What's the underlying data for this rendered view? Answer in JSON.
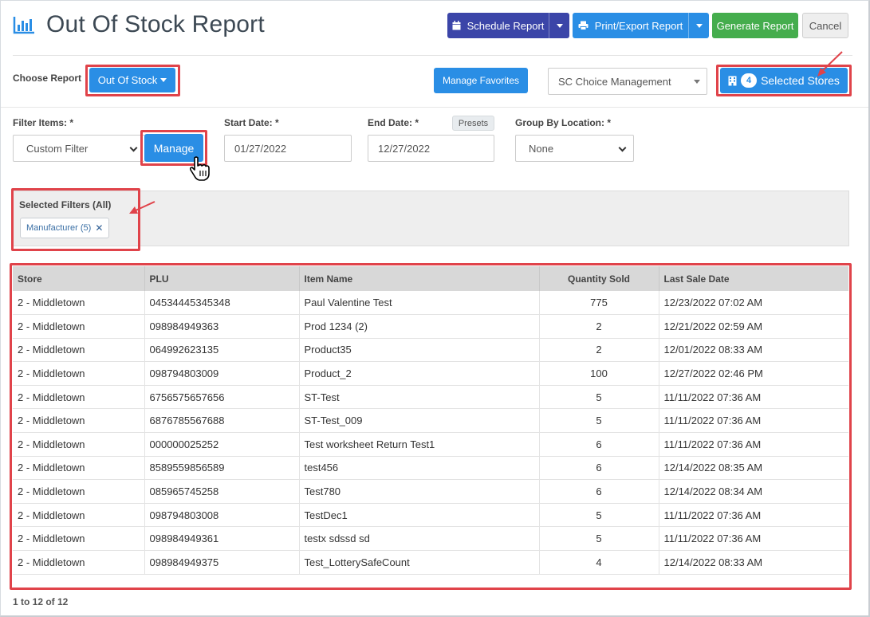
{
  "header": {
    "title": "Out Of Stock Report",
    "title_icon": "bar-chart-icon",
    "schedule_label": "Schedule Report",
    "print_label": "Print/Export Report",
    "generate_label": "Generate Report",
    "cancel_label": "Cancel"
  },
  "report_bar": {
    "choose_label": "Choose Report",
    "report_value": "Out Of Stock",
    "manage_favorites_label": "Manage Favorites",
    "location_value": "SC Choice Management",
    "stores_count": "4",
    "stores_label": "Selected Stores"
  },
  "filters": {
    "filter_items_label": "Filter Items: *",
    "filter_value": "Custom Filter",
    "manage_label": "Manage",
    "start_label": "Start Date: *",
    "start_value": "01/27/2022",
    "end_label": "End Date: *",
    "end_value": "12/27/2022",
    "presets_label": "Presets",
    "group_label": "Group By Location: *",
    "group_value": "None"
  },
  "selected_filters": {
    "title": "Selected Filters (All)",
    "tags": [
      {
        "label": "Manufacturer (5)",
        "remove": "✕"
      }
    ]
  },
  "table": {
    "columns": [
      "Store",
      "PLU",
      "Item Name",
      "Quantity Sold",
      "Last Sale Date"
    ],
    "rows": [
      [
        "2 - Middletown",
        "04534445345348",
        "Paul Valentine Test",
        "775",
        "12/23/2022 07:02 AM"
      ],
      [
        "2 - Middletown",
        "098984949363",
        "Prod 1234 (2)",
        "2",
        "12/21/2022 02:59 AM"
      ],
      [
        "2 - Middletown",
        "064992623135",
        "Product35",
        "2",
        "12/01/2022 08:33 AM"
      ],
      [
        "2 - Middletown",
        "098794803009",
        "Product_2",
        "100",
        "12/27/2022 02:46 PM"
      ],
      [
        "2 - Middletown",
        "6756575657656",
        "ST-Test",
        "5",
        "11/11/2022 07:36 AM"
      ],
      [
        "2 - Middletown",
        "6876785567688",
        "ST-Test_009",
        "5",
        "11/11/2022 07:36 AM"
      ],
      [
        "2 - Middletown",
        "000000025252",
        "Test worksheet Return Test1",
        "6",
        "11/11/2022 07:36 AM"
      ],
      [
        "2 - Middletown",
        "8589559856589",
        "test456",
        "6",
        "12/14/2022 08:35 AM"
      ],
      [
        "2 - Middletown",
        "085965745258",
        "Test780",
        "6",
        "12/14/2022 08:34 AM"
      ],
      [
        "2 - Middletown",
        "098794803008",
        "TestDec1",
        "5",
        "11/11/2022 07:36 AM"
      ],
      [
        "2 - Middletown",
        "098984949361",
        "testx sdssd sd",
        "5",
        "11/11/2022 07:36 AM"
      ],
      [
        "2 - Middletown",
        "098984949375",
        "Test_LotterySafeCount",
        "4",
        "12/14/2022 08:33 AM"
      ]
    ]
  },
  "footer": {
    "pagination": "1 to 12 of 12"
  },
  "colors": {
    "annotation_red": "#e0434a",
    "primary_blue": "#2a8ee5",
    "indigo": "#3b45a8",
    "green": "#45ad4d"
  }
}
